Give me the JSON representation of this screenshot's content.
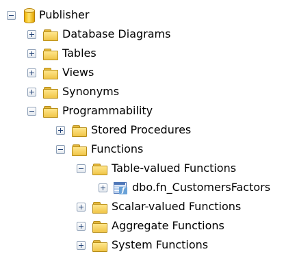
{
  "tree": {
    "root": {
      "label": "Publisher",
      "expanded": true
    },
    "items": {
      "database_diagrams": {
        "label": "Database Diagrams",
        "expanded": false
      },
      "tables": {
        "label": "Tables",
        "expanded": false
      },
      "views": {
        "label": "Views",
        "expanded": false
      },
      "synonyms": {
        "label": "Synonyms",
        "expanded": false
      },
      "programmability": {
        "label": "Programmability",
        "expanded": true
      },
      "stored_procedures": {
        "label": "Stored Procedures",
        "expanded": false
      },
      "functions": {
        "label": "Functions",
        "expanded": true
      },
      "table_valued_functions": {
        "label": "Table-valued Functions",
        "expanded": true
      },
      "fn_customers_factors": {
        "label": "dbo.fn_CustomersFactors",
        "expanded": false
      },
      "scalar_valued_functions": {
        "label": "Scalar-valued Functions",
        "expanded": false
      },
      "aggregate_functions": {
        "label": "Aggregate Functions",
        "expanded": false
      },
      "system_functions": {
        "label": "System Functions",
        "expanded": false
      }
    }
  },
  "colors": {
    "folder_yellow": "#f0c548",
    "toggle_border": "#8d9fb6",
    "text": "#000000"
  }
}
